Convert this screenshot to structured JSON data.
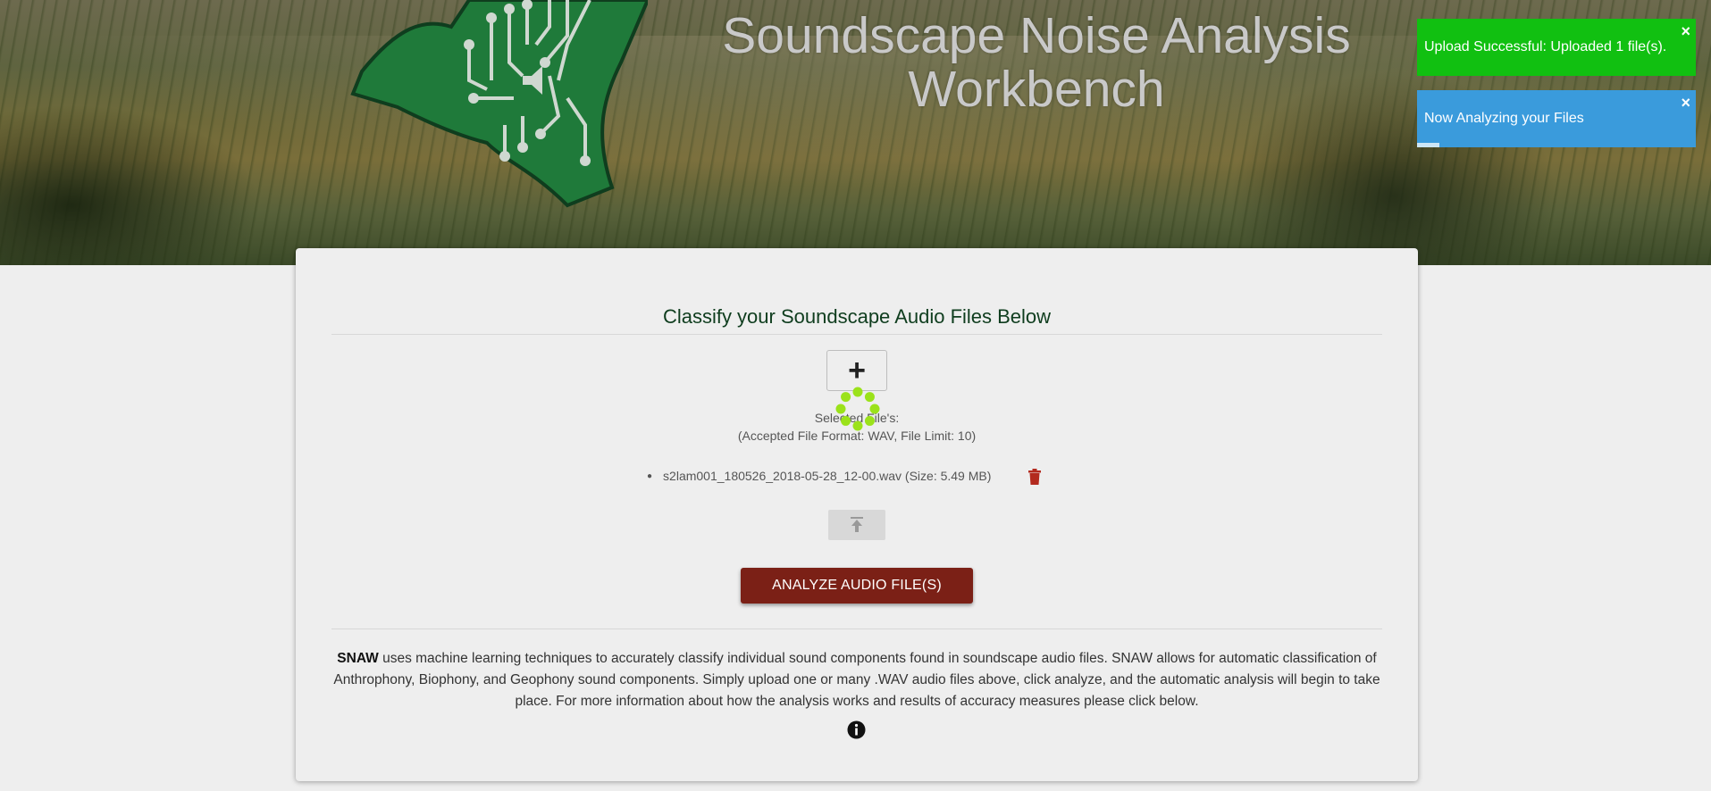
{
  "header": {
    "title": "Soundscape Noise Analysis Workbench"
  },
  "toasts": [
    {
      "message": "Upload Successful: Uploaded 1 file(s).",
      "color": "#11c011",
      "close": "×"
    },
    {
      "message": "Now Analyzing your Files",
      "color": "#3a9bdc",
      "close": "×",
      "progress": 0.08
    }
  ],
  "main": {
    "heading": "Classify your Soundscape Audio Files Below",
    "add_button_icon": "plus-icon",
    "selected_label": "Selected File's:",
    "accepted_label": "(Accepted File Format: WAV, File Limit: 10)",
    "files": [
      {
        "name": "s2lam001_180526_2018-05-28_12-00.wav (Size: 5.49 MB)",
        "delete_icon": "trash-icon"
      }
    ],
    "upload_button_icon": "upload-icon",
    "analyze_button": "ANALYZE AUDIO FILE(S)",
    "description_bold": "SNAW",
    "description_text": " uses machine learning techniques to accurately classify individual sound components found in soundscape audio files. SNAW allows for automatic classification of Anthrophony, Biophony, and Geophony sound components. Simply upload one or many .WAV audio files above, click analyze, and the automatic analysis will begin to take place. For more information about how the analysis works and results of accuracy measures please click below.",
    "info_icon": "info-icon"
  },
  "colors": {
    "accent_green": "#0f3d1e",
    "analyze_button": "#7b2016",
    "spinner": "#9be21a",
    "trash": "#b32a1e"
  }
}
